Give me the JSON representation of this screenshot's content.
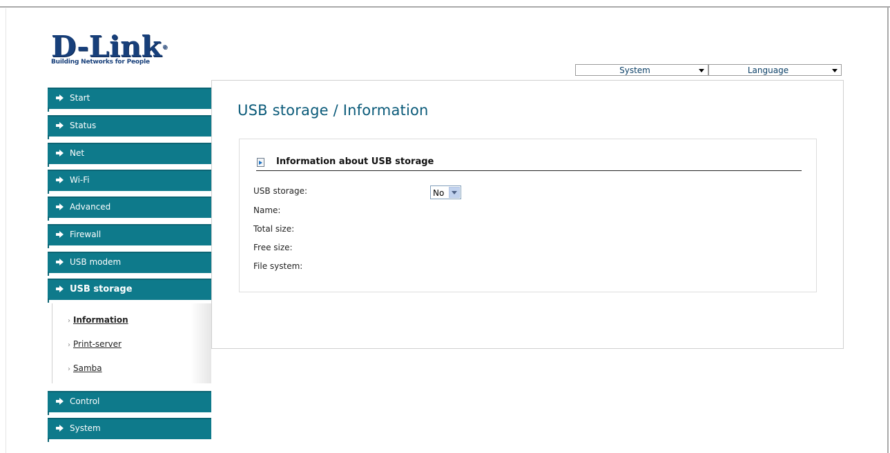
{
  "brand": {
    "name": "D-Link",
    "reg_mark": "®",
    "tagline": "Building Networks for People"
  },
  "top_menu": {
    "system_label": "System",
    "language_label": "Language"
  },
  "nav": {
    "items": [
      {
        "label": "Start"
      },
      {
        "label": "Status"
      },
      {
        "label": "Net"
      },
      {
        "label": "Wi-Fi"
      },
      {
        "label": "Advanced"
      },
      {
        "label": "Firewall"
      },
      {
        "label": "USB modem"
      },
      {
        "label": "USB storage"
      },
      {
        "label": "Control"
      },
      {
        "label": "System"
      }
    ],
    "sub_items": [
      {
        "label": "Information"
      },
      {
        "label": "Print-server"
      },
      {
        "label": "Samba"
      }
    ],
    "sub_bullet": "›"
  },
  "page": {
    "title": "USB storage / Information",
    "panel_title": "Information about USB storage",
    "fields": {
      "usb_storage_label": "USB storage:",
      "usb_storage_value": "No",
      "name_label": "Name:",
      "total_size_label": "Total size:",
      "free_size_label": "Free size:",
      "file_system_label": "File system:"
    }
  },
  "colors": {
    "nav_bg": "#0e7a8b",
    "title": "#0a5a79",
    "brand": "#173f7a"
  }
}
